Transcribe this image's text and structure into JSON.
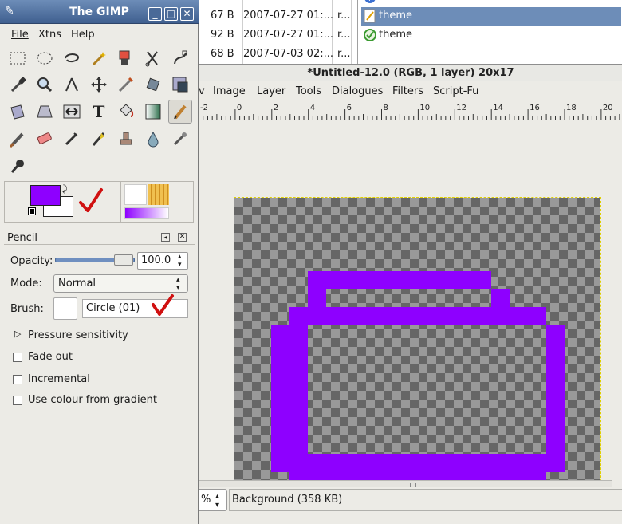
{
  "file_list": {
    "rows": [
      {
        "size": "67 B",
        "date": "2007-07-27 01:...",
        "rest": "r..."
      },
      {
        "size": "92 B",
        "date": "2007-07-27 01:...",
        "rest": "r..."
      },
      {
        "size": "68 B",
        "date": "2007-07-03 02:...",
        "rest": "r..."
      }
    ],
    "right_items": [
      {
        "label": "theme",
        "icon": "theme-edit-icon",
        "selected": true
      },
      {
        "label": "theme",
        "icon": "theme-apply-icon",
        "selected": false
      }
    ]
  },
  "image_window": {
    "title": "*Untitled-12.0 (RGB, 1 layer) 20x17",
    "menu": [
      "v",
      "Image",
      "Layer",
      "Tools",
      "Dialogues",
      "Filters",
      "Script-Fu"
    ],
    "ruler_labels": [
      "-2",
      "0",
      "2",
      "4",
      "6",
      "8",
      "10",
      "12",
      "14",
      "16",
      "18",
      "20"
    ],
    "zoom": "%",
    "status": "Background (358 KB)"
  },
  "toolbox": {
    "title": "The GIMP",
    "menu": [
      "File",
      "Xtns",
      "Help"
    ],
    "tools": [
      "rect-select-icon",
      "ellipse-select-icon",
      "free-select-icon",
      "fuzzy-select-icon",
      "select-by-color-icon",
      "scissors-icon",
      "paths-icon",
      "color-picker-icon",
      "zoom-icon",
      "measure-icon",
      "move-icon",
      "crop-icon",
      "rotate-icon",
      "scale-icon",
      "shear-icon",
      "perspective-icon",
      "flip-icon",
      "text-icon",
      "bucket-fill-icon",
      "blend-icon",
      "pencil-icon",
      "paintbrush-icon",
      "eraser-icon",
      "airbrush-icon",
      "ink-icon",
      "clone-icon",
      "blur-icon",
      "smudge-icon",
      "dodge-burn-icon"
    ],
    "fg_color": "#8e00ff",
    "bg_color": "#ffffff",
    "tool_options": {
      "title": "Pencil",
      "opacity_label": "Opacity:",
      "opacity_value": "100.0",
      "mode_label": "Mode:",
      "mode_value": "Normal",
      "brush_label": "Brush:",
      "brush_value": "Circle (01)",
      "pressure_label": "Pressure sensitivity",
      "options": [
        {
          "label": "Fade out",
          "checked": false
        },
        {
          "label": "Incremental",
          "checked": false
        },
        {
          "label": "Use colour from gradient",
          "checked": false
        }
      ]
    }
  }
}
